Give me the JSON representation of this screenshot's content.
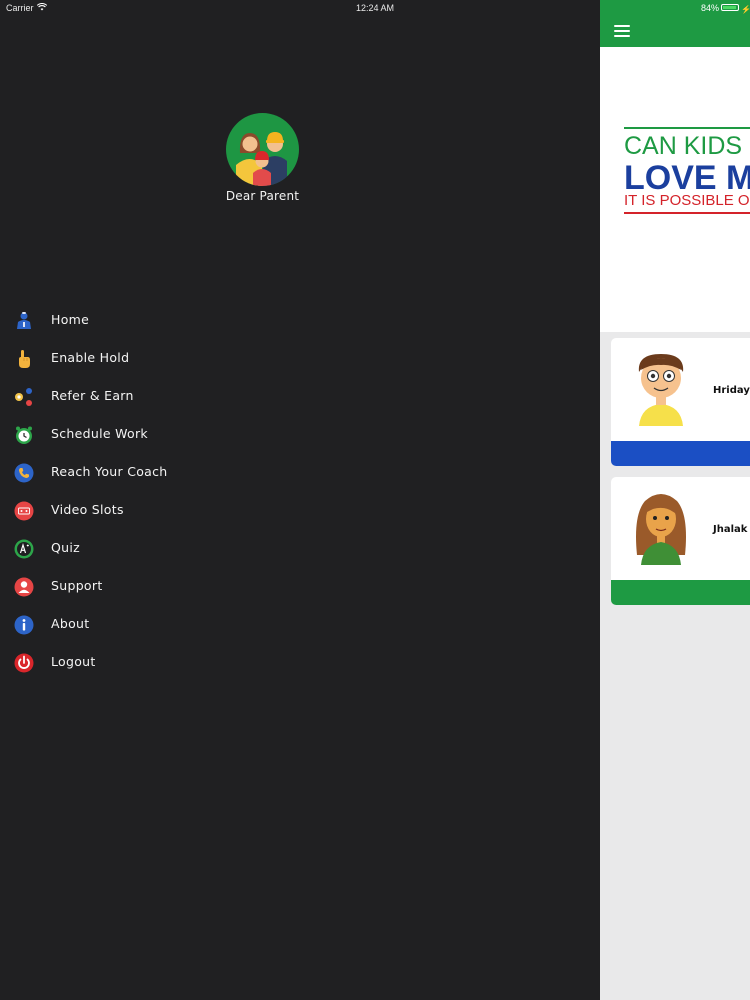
{
  "status_bar": {
    "carrier": "Carrier",
    "time": "12:24 AM",
    "battery_percent": "84%",
    "battery_level": 0.84
  },
  "drawer": {
    "profile": {
      "name": "Dear Parent",
      "avatar_icon": "family-avatar-icon"
    },
    "menu": [
      {
        "label": "Home",
        "icon": "home-icon",
        "color": "#2d64c8"
      },
      {
        "label": "Enable Hold",
        "icon": "hand-pointer-icon",
        "color": "#f3b33d"
      },
      {
        "label": "Refer & Earn",
        "icon": "share-dots-icon",
        "color": "#f1c34a"
      },
      {
        "label": "Schedule Work",
        "icon": "alarm-clock-icon",
        "color": "#2da54a"
      },
      {
        "label": "Reach Your Coach",
        "icon": "phone-icon",
        "color": "#2d64c8"
      },
      {
        "label": "Video Slots",
        "icon": "video-slots-icon",
        "color": "#e64545"
      },
      {
        "label": "Quiz",
        "icon": "quiz-grade-icon",
        "color": "#2da54a"
      },
      {
        "label": "Support",
        "icon": "support-user-icon",
        "color": "#e64545"
      },
      {
        "label": "About",
        "icon": "info-icon",
        "color": "#2d64c8"
      },
      {
        "label": "Logout",
        "icon": "power-icon",
        "color": "#d9262b"
      }
    ]
  },
  "content": {
    "header_color": "#1e9a43",
    "banner": {
      "line1": "CAN KIDS E",
      "line2": "LOVE MA",
      "line3": "IT IS POSSIBLE O"
    },
    "children": [
      {
        "name": "Hriday",
        "bar_color": "#1b4fc4"
      },
      {
        "name": "Jhalak .",
        "bar_color": "#1e9a43"
      }
    ]
  }
}
